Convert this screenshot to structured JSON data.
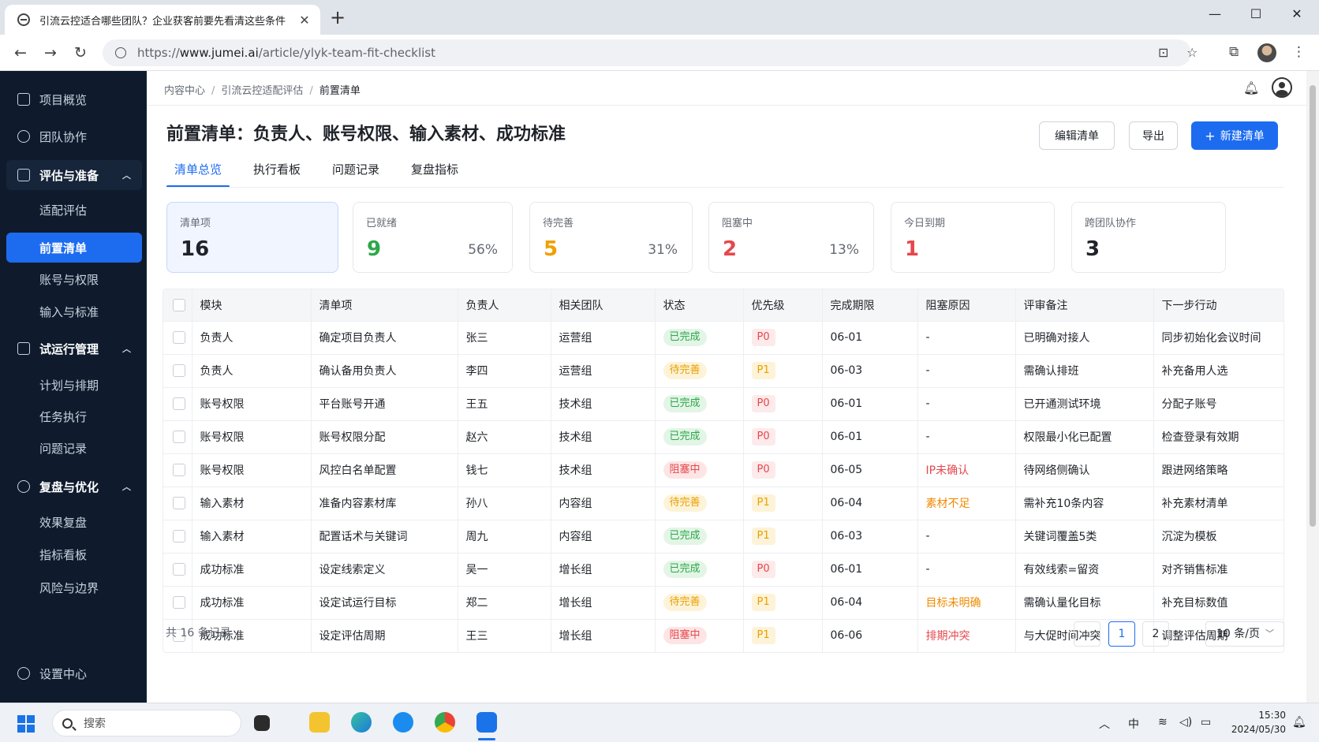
{
  "browser": {
    "tab_title": "引流云控适合哪些团队？企业获客前要先看清这些条件",
    "url_prefix": "https://",
    "url_domain": "www.jumei.ai",
    "url_path": "/article/ylyk-team-fit-checklist"
  },
  "sidebar": {
    "overview": "项目概览",
    "team": "团队协作",
    "group_eval": "评估与准备",
    "eval_items": [
      "适配评估",
      "前置清单",
      "账号与权限",
      "输入与标准"
    ],
    "group_trial": "试运行管理",
    "trial_items": [
      "计划与排期",
      "任务执行",
      "问题记录"
    ],
    "group_review": "复盘与优化",
    "review_items": [
      "效果复盘",
      "指标看板",
      "风险与边界"
    ],
    "settings": "设置中心"
  },
  "breadcrumb": [
    "内容中心",
    "引流云控适配评估",
    "前置清单"
  ],
  "page": {
    "title": "前置清单：负责人、账号权限、输入素材、成功标准",
    "edit_button": "编辑清单",
    "export_button": "导出",
    "new_button": "新建清单"
  },
  "tabs": [
    "清单总览",
    "执行看板",
    "问题记录",
    "复盘指标"
  ],
  "stats": [
    {
      "label": "清单项",
      "value": "16",
      "pct": "",
      "color": "#1f2329"
    },
    {
      "label": "已就绪",
      "value": "9",
      "pct": "56%",
      "color": "#2ba84a"
    },
    {
      "label": "待完善",
      "value": "5",
      "pct": "31%",
      "color": "#f0a000"
    },
    {
      "label": "阻塞中",
      "value": "2",
      "pct": "13%",
      "color": "#e5484d"
    },
    {
      "label": "今日到期",
      "value": "1",
      "pct": "",
      "color": "#e5484d"
    },
    {
      "label": "跨团队协作",
      "value": "3",
      "pct": "",
      "color": "#1f2329"
    }
  ],
  "table": {
    "columns": [
      "模块",
      "清单项",
      "负责人",
      "相关团队",
      "状态",
      "优先级",
      "完成期限",
      "阻塞原因",
      "评审备注",
      "下一步行动"
    ],
    "rows": [
      {
        "module": "负责人",
        "item": "确定项目负责人",
        "owner": "张三",
        "team": "运营组",
        "status": "已完成",
        "status_type": "done",
        "priority": "P0",
        "due": "06-01",
        "reason": "-",
        "reason_type": "",
        "note": "已明确对接人",
        "next": "同步初始化会议时间"
      },
      {
        "module": "负责人",
        "item": "确认备用负责人",
        "owner": "李四",
        "team": "运营组",
        "status": "待完善",
        "status_type": "pending",
        "priority": "P1",
        "due": "06-03",
        "reason": "-",
        "reason_type": "",
        "note": "需确认排班",
        "next": "补充备用人选"
      },
      {
        "module": "账号权限",
        "item": "平台账号开通",
        "owner": "王五",
        "team": "技术组",
        "status": "已完成",
        "status_type": "done",
        "priority": "P0",
        "due": "06-01",
        "reason": "-",
        "reason_type": "",
        "note": "已开通测试环境",
        "next": "分配子账号"
      },
      {
        "module": "账号权限",
        "item": "账号权限分配",
        "owner": "赵六",
        "team": "技术组",
        "status": "已完成",
        "status_type": "done",
        "priority": "P0",
        "due": "06-01",
        "reason": "-",
        "reason_type": "",
        "note": "权限最小化已配置",
        "next": "检查登录有效期"
      },
      {
        "module": "账号权限",
        "item": "风控白名单配置",
        "owner": "钱七",
        "team": "技术组",
        "status": "阻塞中",
        "status_type": "blocked",
        "priority": "P0",
        "due": "06-05",
        "reason": "IP未确认",
        "reason_type": "red",
        "note": "待网络侧确认",
        "next": "跟进网络策略"
      },
      {
        "module": "输入素材",
        "item": "准备内容素材库",
        "owner": "孙八",
        "team": "内容组",
        "status": "待完善",
        "status_type": "pending",
        "priority": "P1",
        "due": "06-04",
        "reason": "素材不足",
        "reason_type": "orange",
        "note": "需补充10条内容",
        "next": "补充素材清单"
      },
      {
        "module": "输入素材",
        "item": "配置话术与关键词",
        "owner": "周九",
        "team": "内容组",
        "status": "已完成",
        "status_type": "done",
        "priority": "P1",
        "due": "06-03",
        "reason": "-",
        "reason_type": "",
        "note": "关键词覆盖5类",
        "next": "沉淀为模板"
      },
      {
        "module": "成功标准",
        "item": "设定线索定义",
        "owner": "吴一",
        "team": "增长组",
        "status": "已完成",
        "status_type": "done",
        "priority": "P0",
        "due": "06-01",
        "reason": "-",
        "reason_type": "",
        "note": "有效线索=留资",
        "next": "对齐销售标准"
      },
      {
        "module": "成功标准",
        "item": "设定试运行目标",
        "owner": "郑二",
        "team": "增长组",
        "status": "待完善",
        "status_type": "pending",
        "priority": "P1",
        "due": "06-04",
        "reason": "目标未明确",
        "reason_type": "orange",
        "note": "需确认量化目标",
        "next": "补充目标数值"
      },
      {
        "module": "成功标准",
        "item": "设定评估周期",
        "owner": "王三",
        "team": "增长组",
        "status": "阻塞中",
        "status_type": "blocked",
        "priority": "P1",
        "due": "06-06",
        "reason": "排期冲突",
        "reason_type": "red",
        "note": "与大促时间冲突",
        "next": "调整评估周期"
      }
    ]
  },
  "footer": {
    "total": "共 16 条记录",
    "pages": [
      "1",
      "2"
    ],
    "page_size": "10 条/页"
  },
  "taskbar": {
    "search_placeholder": "搜索",
    "ime": "中",
    "time": "15:30",
    "date": "2024/05/30"
  }
}
